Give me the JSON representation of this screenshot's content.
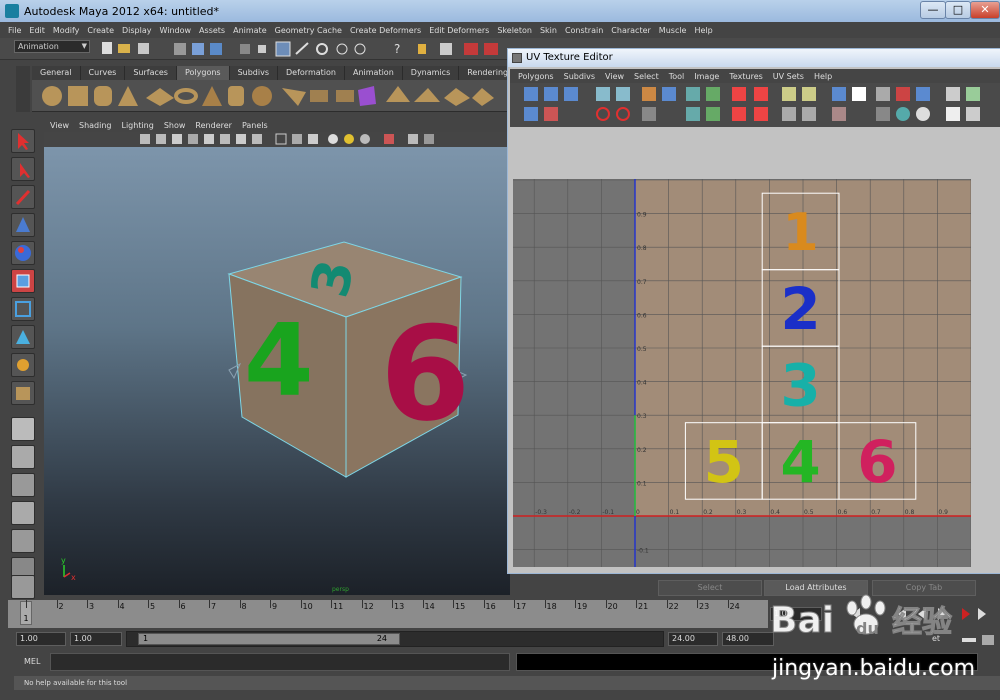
{
  "window": {
    "title": "Autodesk Maya 2012 x64: untitled*"
  },
  "menu": [
    "File",
    "Edit",
    "Modify",
    "Create",
    "Display",
    "Window",
    "Assets",
    "Animate",
    "Geometry Cache",
    "Create Deformers",
    "Edit Deformers",
    "Skeleton",
    "Skin",
    "Constrain",
    "Character",
    "Muscle",
    "Help"
  ],
  "mode_menu": "Animation",
  "shelf_tabs": [
    {
      "label": "General",
      "active": false
    },
    {
      "label": "Curves",
      "active": false
    },
    {
      "label": "Surfaces",
      "active": false
    },
    {
      "label": "Polygons",
      "active": true
    },
    {
      "label": "Subdivs",
      "active": false
    },
    {
      "label": "Deformation",
      "active": false
    },
    {
      "label": "Animation",
      "active": false
    },
    {
      "label": "Dynamics",
      "active": false
    },
    {
      "label": "Rendering",
      "active": false
    },
    {
      "label": "P",
      "active": false
    }
  ],
  "panel_menu": [
    "View",
    "Shading",
    "Lighting",
    "Show",
    "Renderer",
    "Panels"
  ],
  "viewport": {
    "cube_face_labels": {
      "top": "3",
      "left": "4",
      "right": "6"
    },
    "axis": {
      "x": "x",
      "y": "y"
    },
    "view_label": "persp"
  },
  "uv_editor": {
    "title": "UV Texture Editor",
    "menu": [
      "Polygons",
      "Subdivs",
      "View",
      "Select",
      "Tool",
      "Image",
      "Textures",
      "UV Sets",
      "Help"
    ],
    "axis_labels_y": [
      "0.9",
      "0.8",
      "0.7",
      "0.6",
      "0.5",
      "0.4",
      "0.3",
      "0.2",
      "0.1",
      "-0.1"
    ],
    "axis_labels_x": [
      "-0.4",
      "-0.3",
      "-0.2",
      "-0.1",
      "0",
      "0.1",
      "0.2",
      "0.3",
      "0.4",
      "0.5",
      "0.6",
      "0.7",
      "0.8",
      "0.9",
      "1"
    ],
    "axis_one": "1",
    "tiles": [
      {
        "label": "1",
        "color": "#d98a1e"
      },
      {
        "label": "2",
        "color": "#1a2fc8"
      },
      {
        "label": "3",
        "color": "#17b0a8"
      },
      {
        "label": "5",
        "color": "#d2c414"
      },
      {
        "label": "4",
        "color": "#24b624"
      },
      {
        "label": "6",
        "color": "#d0205e"
      }
    ]
  },
  "bottom_buttons": {
    "select": "Select",
    "load": "Load Attributes",
    "copy": "Copy Tab"
  },
  "timeline": {
    "ticks": [
      "1",
      "2",
      "3",
      "4",
      "5",
      "6",
      "7",
      "8",
      "9",
      "10",
      "11",
      "12",
      "13",
      "14",
      "15",
      "16",
      "17",
      "18",
      "19",
      "20",
      "21",
      "22",
      "23",
      "24"
    ],
    "current": "1",
    "current_time": "1.00"
  },
  "range": {
    "start": "1.00",
    "playback_start": "1.00",
    "thumb_start": "1",
    "thumb_end": "24",
    "playback_end": "24.00",
    "end": "48.00",
    "char_set_tail": "et"
  },
  "command_line": {
    "label": "MEL"
  },
  "help_line": "No help available for this tool",
  "watermark": {
    "text": "Bai",
    "text2": "du",
    "cn": "经验",
    "url": "jingyan.baidu.com"
  },
  "colors": {
    "maya_bg": "#444444",
    "texture": "#a28c78",
    "u_axis": "#d02020",
    "v_axis": "#2030d0"
  }
}
